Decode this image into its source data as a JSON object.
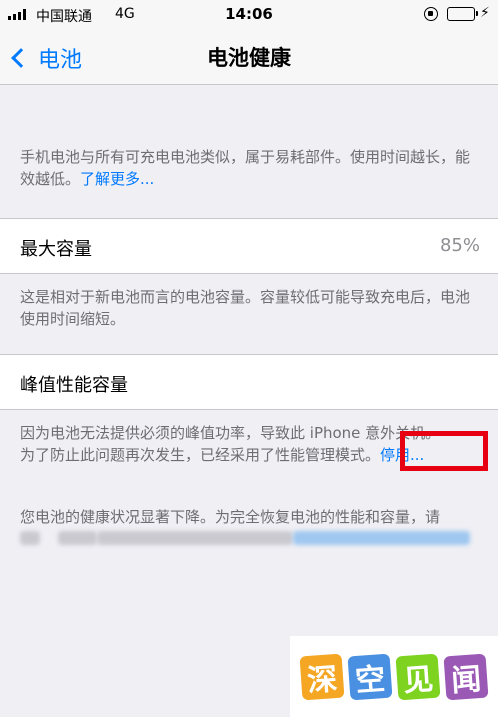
{
  "status_bar": {
    "carrier": "中国联通",
    "network": "4G",
    "time": "14:06",
    "battery_level": 1.0,
    "battery_color": "#4cd964",
    "icons": [
      "signal-icon",
      "orientation-lock-icon",
      "battery-icon",
      "charging-icon"
    ]
  },
  "nav": {
    "back_label": "电池",
    "title": "电池健康"
  },
  "intro": {
    "text": "手机电池与所有可充电电池类似，属于易耗部件。使用时间越长，能效越低。",
    "link": "了解更多..."
  },
  "max_capacity": {
    "label": "最大容量",
    "value": "85%",
    "footer": "这是相对于新电池而言的电池容量。容量较低可能导致充电后，电池使用时间缩短。"
  },
  "peak_performance": {
    "label": "峰值性能容量",
    "footer_line1": "因为电池无法提供必须的峰值功率，导致此 iPhone 意外关机。",
    "footer_line2": "为了防止此问题再次发生，已经采用了性能管理模式。",
    "disable_link": "停用..."
  },
  "health_warning": {
    "line1": "您电池的健康状况显著下降。为完全恢复电池的性能和容量，请"
  },
  "watermark": {
    "chars": [
      "深",
      "空",
      "见",
      "闻"
    ],
    "colors": [
      "#f5a623",
      "#4a90e2",
      "#7ed321",
      "#9b59b6"
    ]
  },
  "accent_color": "#007aff",
  "highlight_color": "#e60012"
}
